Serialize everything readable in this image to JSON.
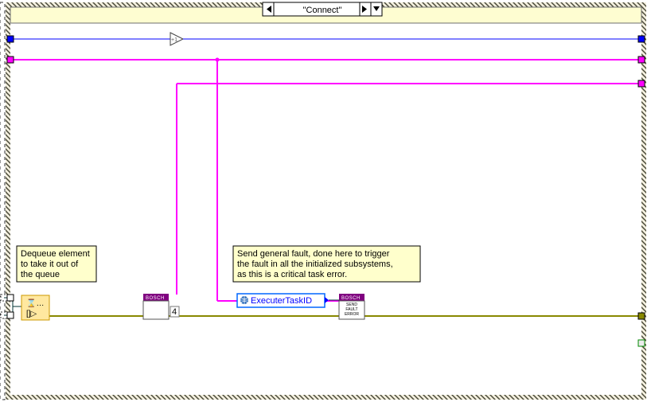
{
  "caseStructure": {
    "selector_label": "\"Connect\""
  },
  "comments": {
    "dequeue": {
      "lines": [
        "Dequeue element",
        "to take it out of",
        "the queue"
      ]
    },
    "fault": {
      "lines": [
        "Send general fault, done here to trigger",
        "the fault in all the initialized subsystems,",
        "as this is a critical task error."
      ]
    }
  },
  "nodes": {
    "bosch1": {
      "header": "BOSCH",
      "body": ""
    },
    "bosch2": {
      "header": "BOSCH",
      "body_l1": "SEND",
      "body_l2": "FAULT",
      "body_l3": "ERROR"
    },
    "queue_primitive": {
      "icon": "⌛…",
      "glyph": "[]▷"
    },
    "constant4": "4",
    "executer_task": {
      "label": "ExecuterTaskID"
    }
  }
}
